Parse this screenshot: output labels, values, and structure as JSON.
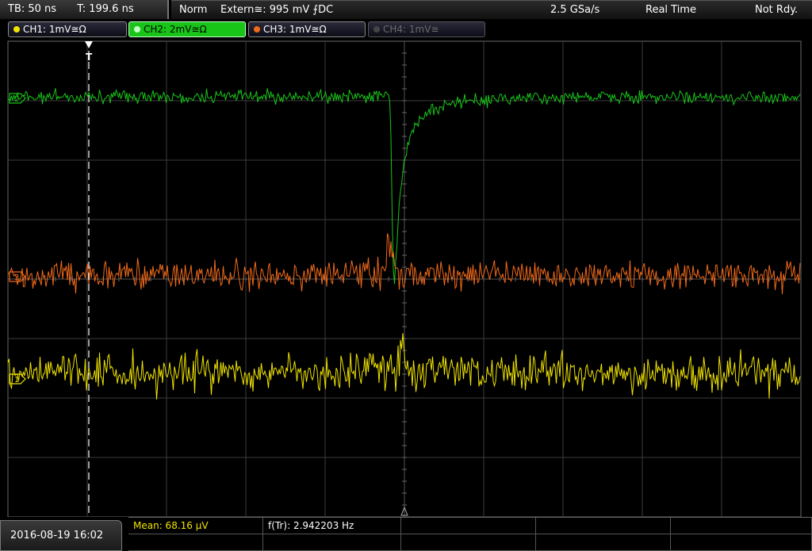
{
  "topbar": {
    "timebase": "TB: 50 ns",
    "trigger_time": "T: 199.6 ns",
    "mode": "Norm",
    "trigger_source": "Extern≅: 995 mV ⨍DC",
    "sample_rate": "2.5 GSa/s",
    "acq_mode": "Real Time",
    "state": "Not Rdy."
  },
  "channels": [
    {
      "label": "CH1: 1mV≅Ω",
      "color": "#f1e400"
    },
    {
      "label": "CH2: 2mV≅Ω",
      "color": "#19c419"
    },
    {
      "label": "CH3: 1mV≅Ω",
      "color": "#f26a19"
    },
    {
      "label": "CH4: 1mV≅",
      "color": "#6a6a6a"
    }
  ],
  "screen": {
    "marker_trigger": "T",
    "ground_labels": [
      "2",
      "3",
      "1"
    ],
    "colors": {
      "ch1": "#f1e400",
      "ch2": "#19c419",
      "ch3": "#f26a19",
      "grid": "#3c3c3c"
    }
  },
  "bottom": {
    "datetime": "2016-08-19 16:02",
    "mean": "Mean: 68.16 µV",
    "frequency": "f(Tr): 2.942203 Hz"
  }
}
